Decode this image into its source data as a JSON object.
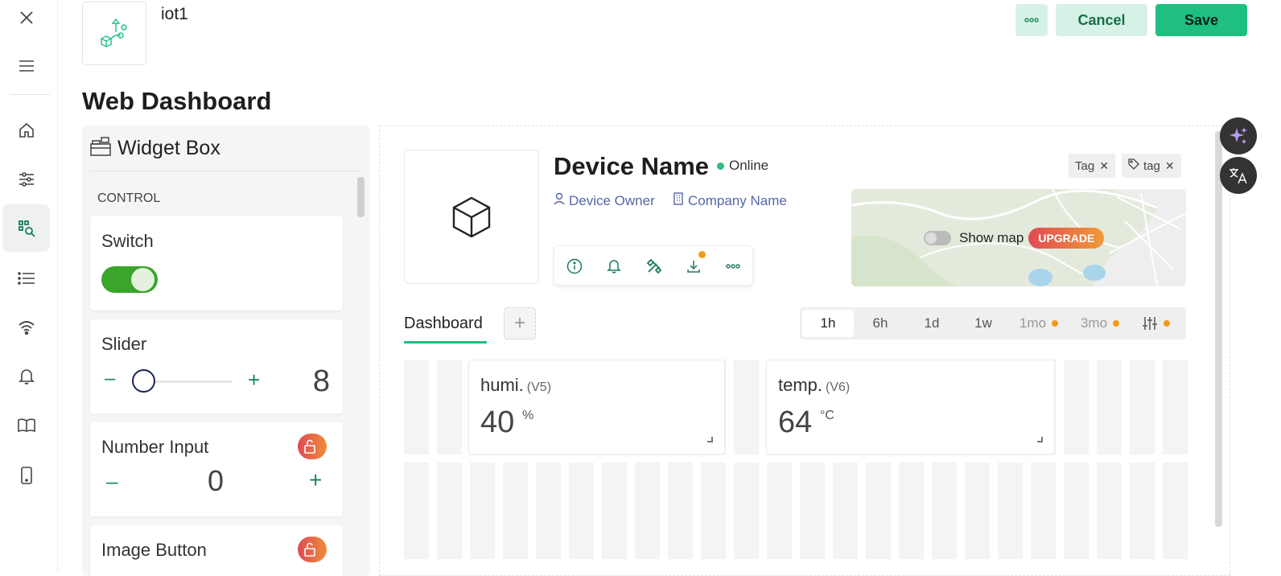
{
  "app": {
    "name": "iot1"
  },
  "header": {
    "cancel_label": "Cancel",
    "save_label": "Save"
  },
  "page": {
    "title": "Web Dashboard"
  },
  "widget_box": {
    "title": "Widget Box",
    "section": "CONTROL",
    "widgets": [
      {
        "title": "Switch",
        "state": "on"
      },
      {
        "title": "Slider",
        "value": "8",
        "minus": "–",
        "plus": "+"
      },
      {
        "title": "Number Input",
        "value": "0",
        "minus": "–",
        "plus": "+"
      },
      {
        "title": "Image Button"
      }
    ]
  },
  "device": {
    "name": "Device Name",
    "status": "Online",
    "owner": "Device Owner",
    "company": "Company Name",
    "tags": [
      "Tag",
      "tag"
    ]
  },
  "map": {
    "show_map_label": "Show map",
    "upgrade_label": "UPGRADE"
  },
  "tabs": {
    "dashboard": "Dashboard",
    "add": "+"
  },
  "time_ranges": [
    "1h",
    "6h",
    "1d",
    "1w",
    "1mo",
    "3mo"
  ],
  "time_range_selected": "1h",
  "tiles": [
    {
      "name": "humi.",
      "pin": "(V5)",
      "value": "40",
      "unit": "%"
    },
    {
      "name": "temp.",
      "pin": "(V6)",
      "value": "64",
      "unit": "°C"
    }
  ],
  "colors": {
    "accent": "#1fbf82",
    "link": "#5566a8",
    "online": "#2bc17b",
    "badge": "#f39a1a"
  }
}
